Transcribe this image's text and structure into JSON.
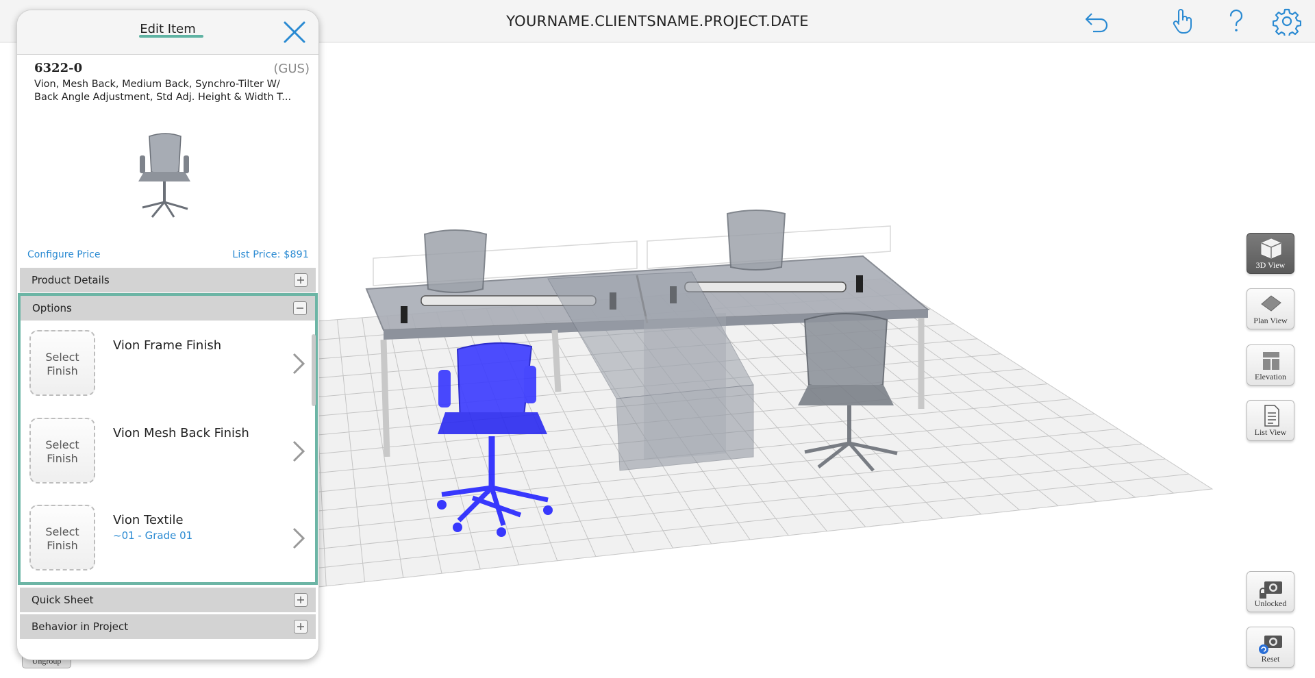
{
  "topbar": {
    "project_title": "YOURNAME.CLIENTSNAME.PROJECT.DATE",
    "icons": [
      "undo-icon",
      "hand-pointer-icon",
      "help-icon",
      "gear-icon"
    ],
    "accent_color": "#2a8ad2"
  },
  "panel": {
    "title": "Edit Item",
    "item": {
      "code": "6322-0",
      "vendor": "(GUS)",
      "description_line1": "Vion, Mesh Back, Medium Back, Synchro-Tilter W/",
      "description_line2": "Back Angle Adjustment, Std Adj. Height & Width T..."
    },
    "configure_price_label": "Configure Price",
    "list_price": "List Price: $891",
    "sections": {
      "product_details": "Product Details",
      "options": "Options",
      "quick_sheet": "Quick Sheet",
      "behavior": "Behavior in Project"
    },
    "options": [
      {
        "swatch_line1": "Select",
        "swatch_line2": "Finish",
        "name": "Vion Frame Finish",
        "value": ""
      },
      {
        "swatch_line1": "Select",
        "swatch_line2": "Finish",
        "name": "Vion Mesh Back Finish",
        "value": ""
      },
      {
        "swatch_line1": "Select",
        "swatch_line2": "Finish",
        "name": "Vion Textile",
        "value": "~01 - Grade 01"
      }
    ]
  },
  "tools": {
    "view_3d": "3D View",
    "plan_view": "Plan View",
    "elevation": "Elevation",
    "list_view": "List View",
    "unlocked": "Unlocked",
    "reset": "Reset"
  },
  "ungroup_label": "Ungroup",
  "colors": {
    "selected_chair": "#2424ff",
    "options_border": "#6cb5a5",
    "link": "#2a8ad2"
  }
}
